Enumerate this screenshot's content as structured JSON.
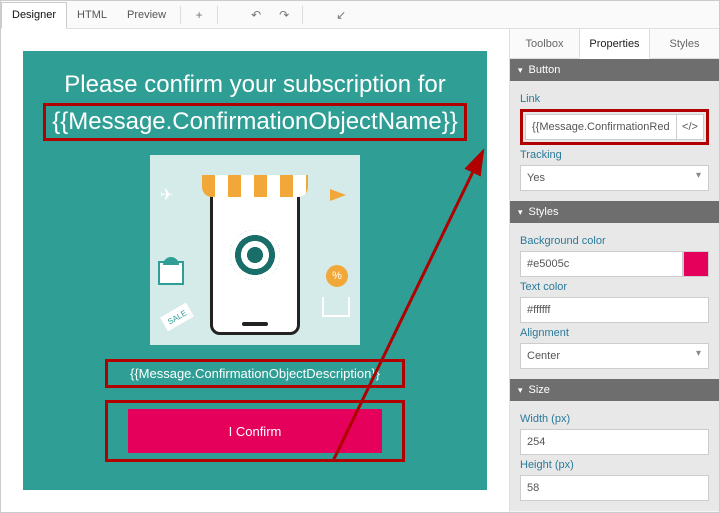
{
  "top_tabs": {
    "designer": "Designer",
    "html": "HTML",
    "preview": "Preview"
  },
  "canvas": {
    "headline": "Please confirm your subscription for",
    "object_name": "{{Message.ConfirmationObjectName}}",
    "description": "{{Message.ConfirmationObjectDescription}}",
    "confirm_label": "I Confirm",
    "sale_tag": "SALE",
    "percent": "%"
  },
  "side_tabs": {
    "toolbox": "Toolbox",
    "properties": "Properties",
    "styles": "Styles"
  },
  "sections": {
    "button": {
      "title": "Button",
      "link_label": "Link",
      "link_value": "{{Message.ConfirmationRedirectURL}}",
      "code_btn": "</>",
      "tracking_label": "Tracking",
      "tracking_value": "Yes"
    },
    "styles": {
      "title": "Styles",
      "bg_label": "Background color",
      "bg_value": "#e5005c",
      "text_label": "Text color",
      "text_value": "#ffffff",
      "align_label": "Alignment",
      "align_value": "Center"
    },
    "size": {
      "title": "Size",
      "width_label": "Width (px)",
      "width_value": "254",
      "height_label": "Height (px)",
      "height_value": "58"
    }
  }
}
